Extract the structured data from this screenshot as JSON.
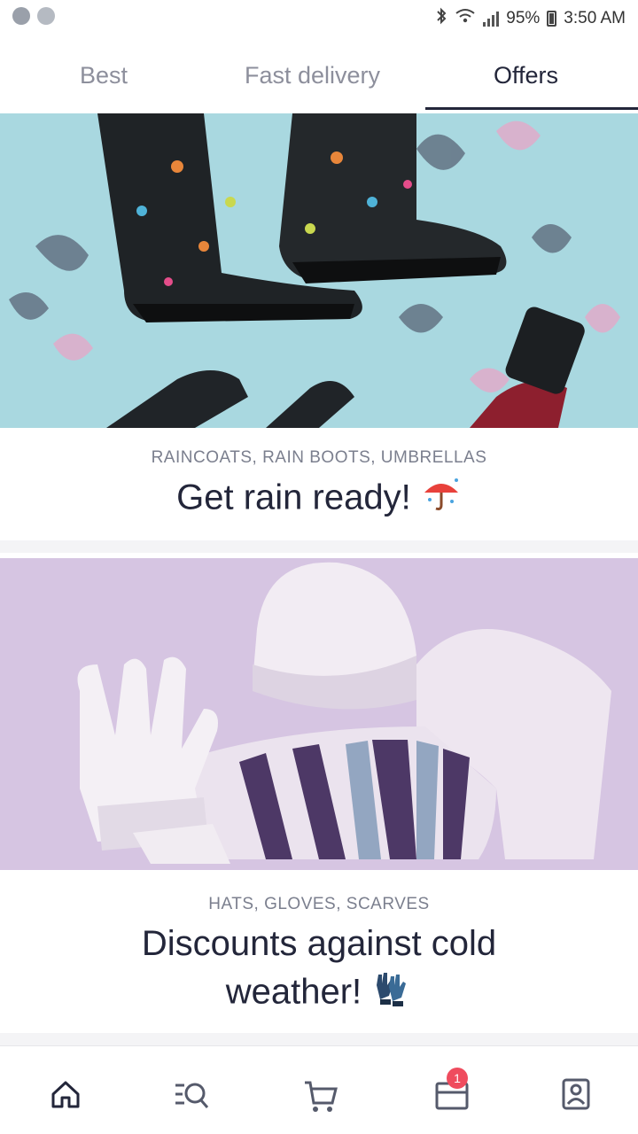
{
  "status_bar": {
    "battery": "95%",
    "time": "3:50 AM",
    "icons": [
      "bluetooth-icon",
      "wifi-icon",
      "signal-icon",
      "battery-icon"
    ]
  },
  "tabs": [
    {
      "label": "Best",
      "active": false
    },
    {
      "label": "Fast delivery",
      "active": false
    },
    {
      "label": "Offers",
      "active": true
    }
  ],
  "banners": [
    {
      "subtitle": "RAINCOATS, RAIN BOOTS, UMBRELLAS",
      "headline": "Get rain ready!",
      "emoji_icon": "umbrella-icon"
    },
    {
      "subtitle": "HATS, GLOVES, SCARVES",
      "headline_line1": "Discounts against cold",
      "headline_line2": "weather!",
      "emoji_icon": "gloves-icon"
    }
  ],
  "bottom_nav": {
    "items": [
      "home-icon",
      "search-catalog-icon",
      "cart-icon",
      "orders-icon",
      "profile-icon"
    ],
    "orders_badge": "1"
  },
  "colors": {
    "text_dark": "#23263a",
    "text_muted": "#8d8f9c",
    "badge": "#ef4c5e",
    "rain_bg": "#a9d8e0",
    "winter_bg": "#d6c5e2"
  }
}
